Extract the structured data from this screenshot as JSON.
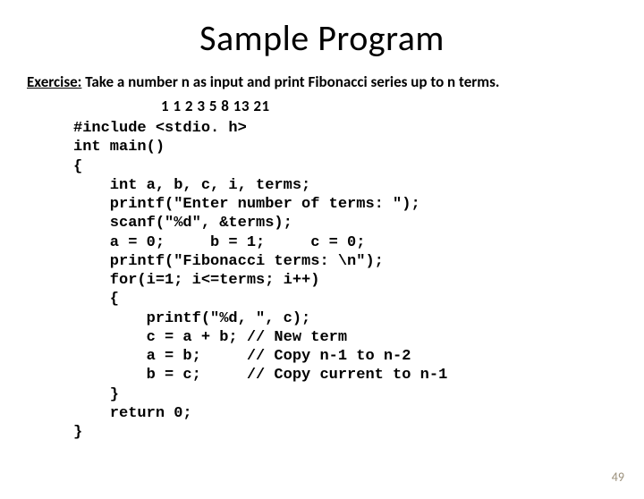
{
  "title": "Sample Program",
  "exercise": {
    "label": "Exercise:",
    "text": "Take a number n as input and print Fibonacci series up to n terms."
  },
  "fib_sequence": "1  1  2  3  5  8  13  21",
  "code_lines": [
    "#include <stdio. h>",
    "int main()",
    "{",
    "    int a, b, c, i, terms;",
    "    printf(\"Enter number of terms: \");",
    "    scanf(\"%d\", &terms);",
    "    a = 0;     b = 1;     c = 0;",
    "    printf(\"Fibonacci terms: \\n\");",
    "    for(i=1; i<=terms; i++)",
    "    {",
    "        printf(\"%d, \", c);",
    "        c = a + b; // New term",
    "        a = b;     // Copy n-1 to n-2",
    "        b = c;     // Copy current to n-1",
    "    }",
    "    return 0;",
    "}"
  ],
  "page_number": "49"
}
